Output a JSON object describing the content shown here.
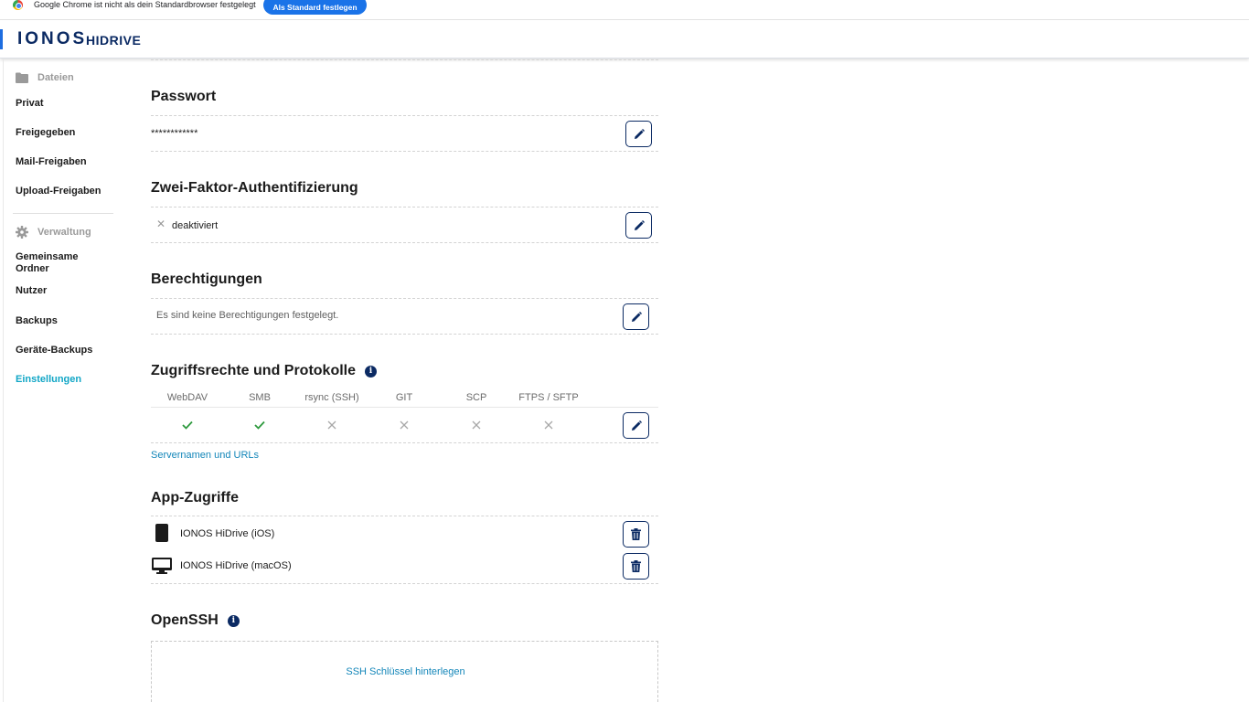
{
  "infobar": {
    "message": "Google Chrome ist nicht als dein Standardbrowser festgelegt",
    "button": "Als Standard festlegen"
  },
  "header": {
    "logo": "IONOS",
    "product": "HIDRIVE"
  },
  "sidebar": {
    "files_section": {
      "label": "Dateien",
      "icon": "folder-icon"
    },
    "file_items": [
      "Privat",
      "Freigegeben",
      "Mail-Freigaben",
      "Upload-Freigaben"
    ],
    "admin_section": {
      "label": "Verwaltung",
      "icon": "gear-icon"
    },
    "admin_items": [
      "Gemeinsame Ordner",
      "Nutzer",
      "Backups",
      "Geräte-Backups",
      "Einstellungen"
    ],
    "active_item": "Einstellungen"
  },
  "main": {
    "password": {
      "title": "Passwort",
      "value": "************"
    },
    "two_factor": {
      "title": "Zwei-Faktor-Authentifizierung",
      "status": "deaktiviert"
    },
    "permissions": {
      "title": "Berechtigungen",
      "text": "Es sind keine Berechtigungen festgelegt."
    },
    "protocols": {
      "title": "Zugriffsrechte und Protokolle",
      "items": [
        {
          "name": "WebDAV",
          "enabled": true
        },
        {
          "name": "SMB",
          "enabled": true
        },
        {
          "name": "rsync (SSH)",
          "enabled": false
        },
        {
          "name": "GIT",
          "enabled": false
        },
        {
          "name": "SCP",
          "enabled": false
        },
        {
          "name": "FTPS / SFTP",
          "enabled": false
        }
      ],
      "link": "Servernamen und URLs"
    },
    "app_access": {
      "title": "App-Zugriffe",
      "apps": [
        {
          "name": "IONOS HiDrive (iOS)",
          "icon": "phone-icon"
        },
        {
          "name": "IONOS HiDrive (macOS)",
          "icon": "monitor-icon"
        }
      ]
    },
    "openssh": {
      "title": "OpenSSH",
      "link": "SSH Schlüssel hinterlegen"
    }
  },
  "colors": {
    "brand": "#0b2a63",
    "active": "#11a6c6",
    "link": "#1386b9",
    "check": "#2e9a3e"
  }
}
